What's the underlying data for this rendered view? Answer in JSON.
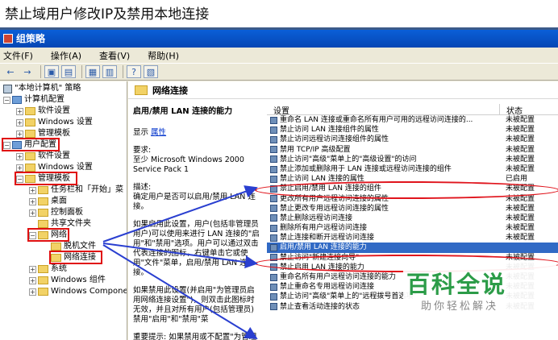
{
  "page_title": "禁止域用户修改IP及禁用本地连接",
  "window": {
    "title": "组策略",
    "menu": [
      "文件(F)",
      "操作(A)",
      "查看(V)",
      "帮助(H)"
    ]
  },
  "tree": [
    {
      "label": "\"本地计算机\" 策略",
      "icon": "policy-icon"
    },
    {
      "label": "计算机配置",
      "icon": "computer-icon"
    },
    {
      "label": "软件设置",
      "icon": "folder-icon"
    },
    {
      "label": "Windows 设置",
      "icon": "folder-icon"
    },
    {
      "label": "管理模板",
      "icon": "folder-icon"
    },
    {
      "label": "用户配置",
      "icon": "user-icon"
    },
    {
      "label": "软件设置",
      "icon": "folder-icon"
    },
    {
      "label": "Windows 设置",
      "icon": "folder-icon"
    },
    {
      "label": "管理模板",
      "icon": "folder-icon"
    },
    {
      "label": "任务栏和「开始」菜",
      "icon": "folder-icon"
    },
    {
      "label": "桌面",
      "icon": "folder-icon"
    },
    {
      "label": "控制面板",
      "icon": "folder-icon"
    },
    {
      "label": "共享文件夹",
      "icon": "folder-icon"
    },
    {
      "label": "网络",
      "icon": "folder-icon"
    },
    {
      "label": "脱机文件",
      "icon": "folder-icon"
    },
    {
      "label": "网络连接",
      "icon": "folder-icon"
    },
    {
      "label": "系统",
      "icon": "folder-icon"
    },
    {
      "label": "Windows 组件",
      "icon": "folder-icon"
    },
    {
      "label": "Windows Components",
      "icon": "folder-icon"
    }
  ],
  "pane_header": "网络连接",
  "description": {
    "title": "启用/禁用 LAN 连接的能力",
    "show_label": "显示",
    "show_link": "属性",
    "req_label": "要求:",
    "req_text": "至少 Microsoft Windows 2000 Service Pack 1",
    "desc_label": "描述:",
    "desc_text": "确定用户是否可以启用/禁用 LAN 连接。",
    "p1": "如果启用此设置，用户(包括非管理员用户)可以使用来进行 LAN 连接的\"启用\"和\"禁用\"选项。用户可以通过双击代表连接的图标，右键单击它或使用\"文件\"菜单，启用/禁用 LAN 连接。",
    "p2": "如果禁用此设置(并启用\"为管理员启用网络连接设置\")，则双击此图标时无效，并且对所有用户(包括管理员)禁用\"启用\"和\"禁用\"菜",
    "p3": "重要提示: 如果禁用或不配置\"为管理员启用网络连接设置\"，此设置将"
  },
  "list": {
    "col_setting": "设置",
    "col_state": "状态",
    "rows": [
      {
        "name": "重命名 LAN 连接或重命名所有用户可用的远程访问连接的...",
        "state": "未被配置"
      },
      {
        "name": "禁止访问 LAN 连接组件的属性",
        "state": "未被配置"
      },
      {
        "name": "禁止访问远程访问连接组件的属性",
        "state": "未被配置"
      },
      {
        "name": "禁用 TCP/IP 高级配置",
        "state": "未被配置"
      },
      {
        "name": "禁止访问\"高级\"菜单上的\"高级设置\"的访问",
        "state": "未被配置"
      },
      {
        "name": "禁止添加或删除用于 LAN 连接或远程访问连接的组件",
        "state": "未被配置"
      },
      {
        "name": "禁止访问 LAN 连接的属性",
        "state": "已启用"
      },
      {
        "name": "禁止启用/禁用 LAN 连接的组件",
        "state": "未被配置"
      },
      {
        "name": "更改所有用户远程访问连接的属性",
        "state": "未被配置"
      },
      {
        "name": "禁止更改专用远程访问连接的属性",
        "state": "未被配置"
      },
      {
        "name": "禁止删除远程访问连接",
        "state": "未被配置"
      },
      {
        "name": "删除所有用户远程访问连接",
        "state": "未被配置"
      },
      {
        "name": "禁止连接和断开远程访问连接",
        "state": "未被配置"
      },
      {
        "name": "启用/禁用 LAN 连接的能力",
        "state": "",
        "selected": true
      },
      {
        "name": "禁止访问\"新建连接向导\"",
        "state": "未被配置"
      },
      {
        "name": "禁止启用 LAN 连接的能力",
        "state": "未被配置"
      },
      {
        "name": "重命名所有用户远程访问连接的能力",
        "state": "未被配置"
      },
      {
        "name": "禁止重命名专用远程访问连接",
        "state": "未被配置"
      },
      {
        "name": "禁止访问\"高级\"菜单上的\"远程拨号首选项\"",
        "state": "未被配置"
      },
      {
        "name": "禁止查看活动连接的状态",
        "state": "未被配置"
      }
    ]
  },
  "watermark": {
    "logo": "百科全说",
    "slogan": "助你轻松解决"
  },
  "colors": {
    "annotation_red": "#e01010",
    "arrow_blue": "#2a3fd0",
    "selection": "#316ac5"
  }
}
